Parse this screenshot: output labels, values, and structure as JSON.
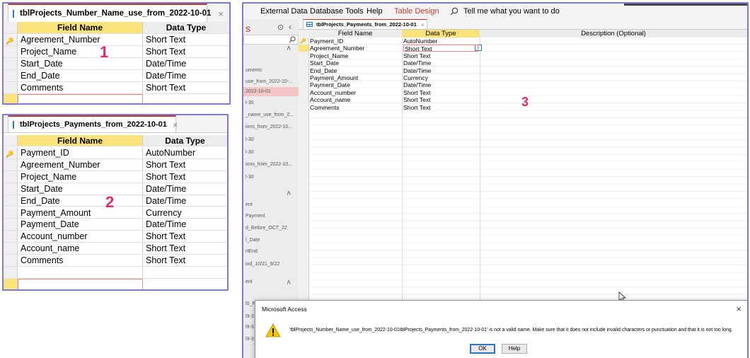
{
  "panel1": {
    "tab_label": "tblProjects_Number_Name_use_from_2022-10-01",
    "close": "×",
    "headers": {
      "field_name": "Field Name",
      "data_type": "Data Type"
    },
    "rows": [
      {
        "field": "Agreement_Number",
        "type": "Short Text"
      },
      {
        "field": "Project_Name",
        "type": "Short Text"
      },
      {
        "field": "Start_Date",
        "type": "Date/Time"
      },
      {
        "field": "End_Date",
        "type": "Date/Time"
      },
      {
        "field": "Comments",
        "type": "Short Text"
      }
    ],
    "marker": "1"
  },
  "panel2": {
    "tab_label": "tblProjects_Payments_from_2022-10-01",
    "close": "×",
    "headers": {
      "field_name": "Field Name",
      "data_type": "Data Type"
    },
    "rows": [
      {
        "field": "Payment_ID",
        "type": "AutoNumber"
      },
      {
        "field": "Agreement_Number",
        "type": "Short Text"
      },
      {
        "field": "Project_Name",
        "type": "Short Text"
      },
      {
        "field": "Start_Date",
        "type": "Date/Time"
      },
      {
        "field": "End_Date",
        "type": "Date/Time"
      },
      {
        "field": "Payment_Amount",
        "type": "Currency"
      },
      {
        "field": "Payment_Date",
        "type": "Date/Time"
      },
      {
        "field": "Account_number",
        "type": "Short Text"
      },
      {
        "field": "Account_name",
        "type": "Short Text"
      },
      {
        "field": "Comments",
        "type": "Short Text"
      }
    ],
    "marker": "2"
  },
  "panel3": {
    "ribbon": [
      "External Data",
      "Database Tools",
      "Help",
      "Table Design"
    ],
    "tell_me": "Tell me what you want to do",
    "nav_title": "s",
    "nav_items": [
      "uments",
      "use_from_2022-10-...",
      "2022-10-01",
      "l-30",
      "_name_use_from_2...",
      "ions_from_2022-10...",
      "l-30",
      "l-30",
      "ions_from_2022-10...",
      "l-30",
      "ent",
      "Payment",
      "d_Before_OCT_22",
      "l_Date",
      "rtEnd",
      "iod_10/21_9/22",
      "ent",
      "l0_P",
      "l9-3",
      "l9-3",
      "l9-3"
    ],
    "tab_label": "tblProjects_Payments_from_2022-10-01",
    "close": "×",
    "headers": {
      "field_name": "Field Name",
      "data_type": "Data Type",
      "description": "Description (Optional)"
    },
    "rows": [
      {
        "field": "Payment_ID",
        "type": "AutoNumber"
      },
      {
        "field": "Agreement_Number",
        "type": "Short Text"
      },
      {
        "field": "Project_Name",
        "type": "Short Text"
      },
      {
        "field": "Start_Date",
        "type": "Date/Time"
      },
      {
        "field": "End_Date",
        "type": "Date/Time"
      },
      {
        "field": "Payment_Amount",
        "type": "Currency"
      },
      {
        "field": "Payment_Date",
        "type": "Date/Time"
      },
      {
        "field": "Account_number",
        "type": "Short Text"
      },
      {
        "field": "Account_name",
        "type": "Short Text"
      },
      {
        "field": "Comments",
        "type": "Short Text"
      }
    ],
    "marker": "3"
  },
  "dialog": {
    "title": "Microsoft Access",
    "close": "×",
    "message": "'tblProjects_Number_Name_use_from_2022-10-01tblProjects_Payments_from_2022-10-01' is not a valid name. Make sure that it does not include invalid characters or punctuation and that it is not too long.",
    "ok_label": "OK",
    "help_label": "Help"
  }
}
